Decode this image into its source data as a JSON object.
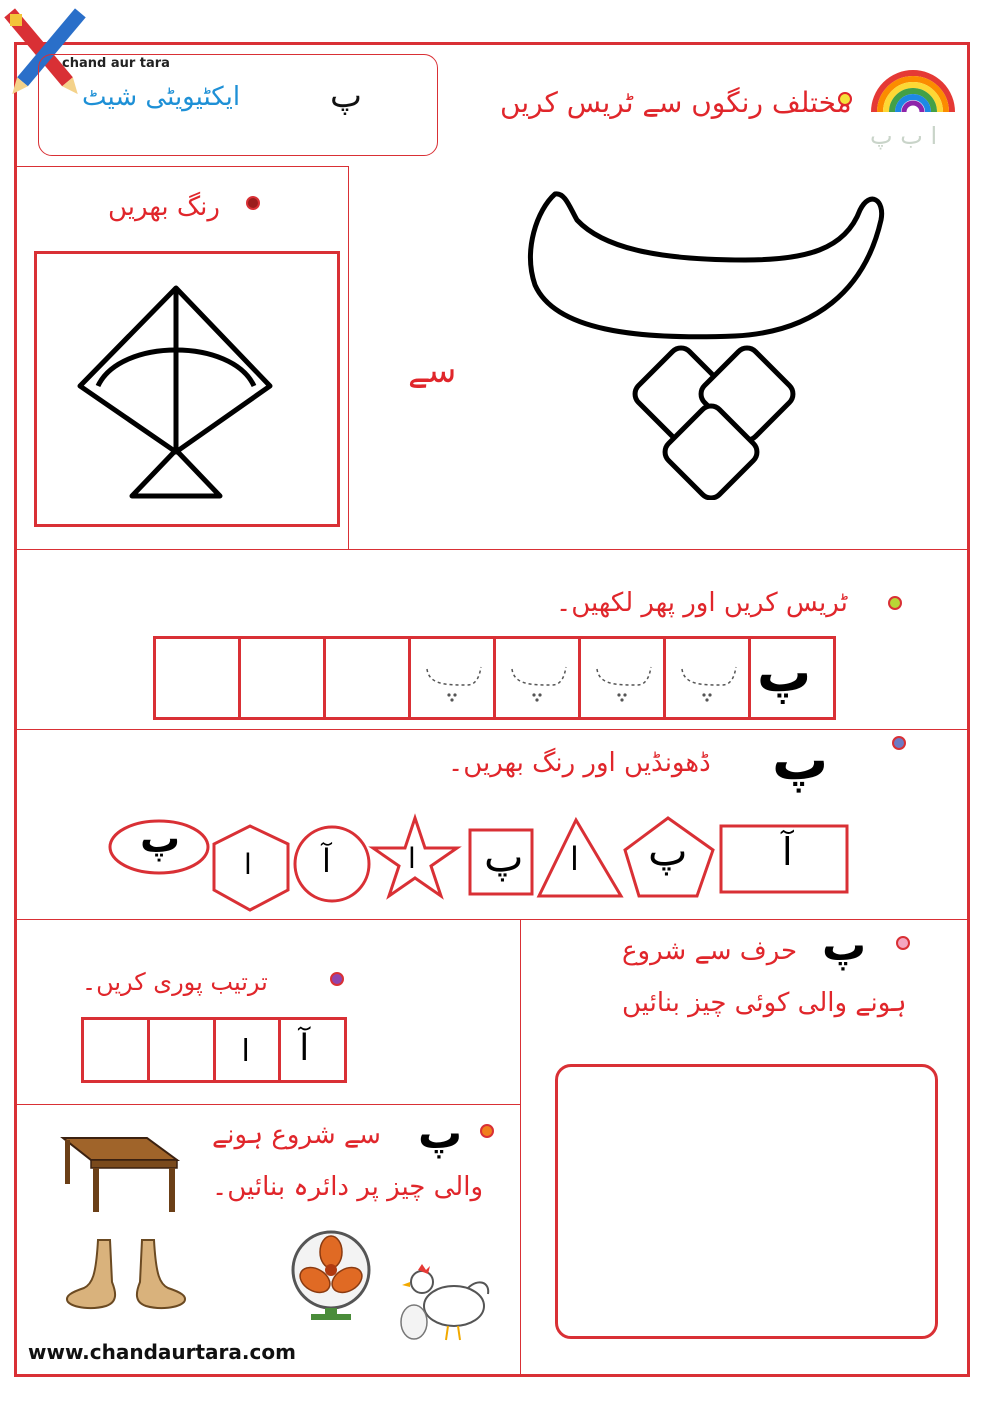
{
  "header": {
    "brand": "chand aur tara",
    "sheet_title": "ایکٹیویٹی شیٹ",
    "letter": "پ"
  },
  "trace_section": {
    "instruction": "مختلف رنگوں سے ٹریس کریں",
    "letter": "پ",
    "se": "سے",
    "alphabet_hint": "ا ب پ"
  },
  "coloring_section": {
    "instruction": "رنگ بھریں"
  },
  "trace_write_section": {
    "instruction": "ٹریس کریں اور پھر لکھیں۔",
    "model_letter": "پ",
    "boxes": [
      "",
      "",
      "",
      "",
      "",
      "",
      "",
      ""
    ]
  },
  "find_section": {
    "letter": "پ",
    "instruction": "ڈھونڈیں اور رنگ بھریں۔",
    "shapes": [
      {
        "shape": "rectangle",
        "letter": "آ"
      },
      {
        "shape": "pentagon",
        "letter": "پ"
      },
      {
        "shape": "triangle",
        "letter": "ا"
      },
      {
        "shape": "square",
        "letter": "پ"
      },
      {
        "shape": "star",
        "letter": "ا"
      },
      {
        "shape": "circle",
        "letter": "آ"
      },
      {
        "shape": "hexagon",
        "letter": "ا"
      },
      {
        "shape": "ellipse",
        "letter": "پ"
      }
    ]
  },
  "sequence_section": {
    "instruction": "ترتیب پوری کریں۔",
    "boxes": [
      "آ",
      "ا",
      "",
      ""
    ]
  },
  "draw_section": {
    "letter": "پ",
    "line1": "حرف سے شروع",
    "line2": "ہونے والی کوئی چیز بنائیں"
  },
  "circle_section": {
    "letter": "پ",
    "line1": "سے شروع ہونے",
    "line2": "والی چیز پر دائرہ بنائیں۔",
    "pictures": [
      "table-icon",
      "feet-icon",
      "fan-icon",
      "hen-icon"
    ]
  },
  "footer": {
    "url": "www.chandaurtara.com"
  },
  "colors": {
    "border": "#d93035",
    "heading_red": "#e0262b",
    "sheet_title_blue": "#1e90d6"
  }
}
